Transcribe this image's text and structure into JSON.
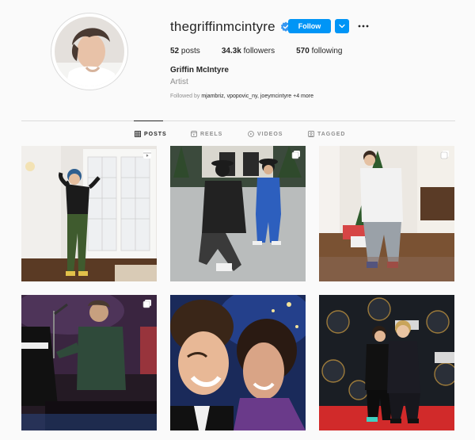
{
  "profile": {
    "username": "thegriffinmcintyre",
    "follow_label": "Follow",
    "posts_count": "52",
    "posts_label": "posts",
    "followers_count": "34.3k",
    "followers_label": "followers",
    "following_count": "570",
    "following_label": "following",
    "full_name": "Griffin McIntyre",
    "category": "Artist",
    "followed_by_prefix": "Followed by",
    "followed_by_users": "mjambriz, vpopovic_ny, joeymcintyre",
    "followed_by_more": "+4 more"
  },
  "tabs": [
    {
      "label": "POSTS",
      "icon": "grid-icon"
    },
    {
      "label": "REELS",
      "icon": "reels-icon"
    },
    {
      "label": "VIDEOS",
      "icon": "igtv-icon"
    },
    {
      "label": "TAGGED",
      "icon": "tagged-icon"
    }
  ],
  "posts": [
    {
      "icon": "reel-icon"
    },
    {
      "icon": "carousel-icon"
    },
    {
      "icon": "carousel-icon"
    },
    {
      "icon": "carousel-icon"
    },
    {
      "icon": ""
    },
    {
      "icon": ""
    }
  ],
  "colors": {
    "accent": "#0095f6",
    "background": "#fafafa",
    "border": "#dbdbdb",
    "secondary_text": "#8e8e8e",
    "primary_text": "#262626"
  }
}
